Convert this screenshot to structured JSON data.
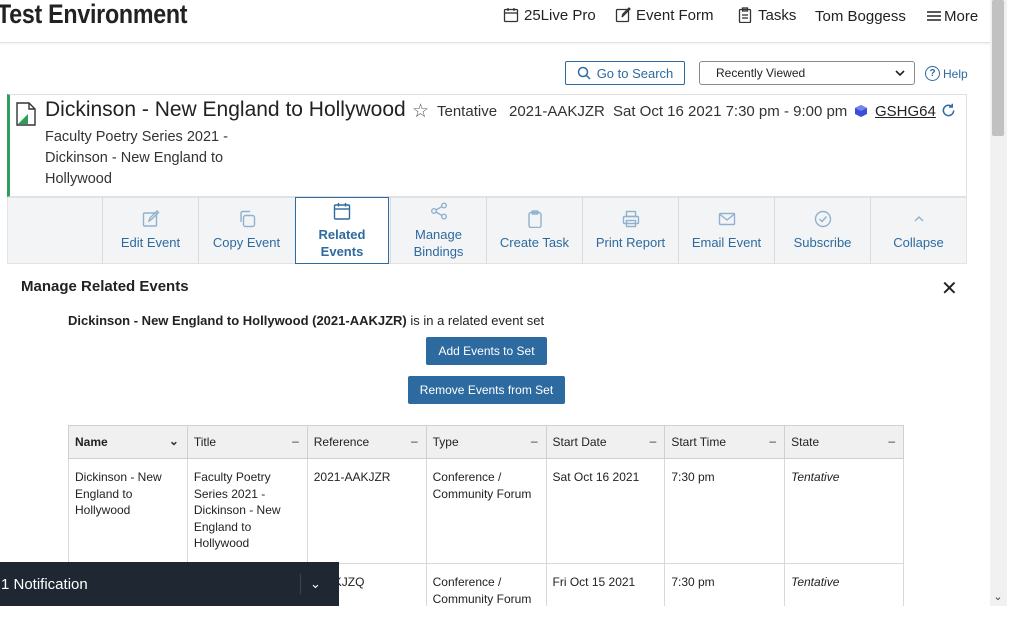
{
  "header": {
    "app_title": "Test Environment",
    "nav": {
      "pro": "25Live Pro",
      "event_form": "Event Form",
      "tasks": "Tasks",
      "user": "Tom Boggess",
      "more": "More"
    }
  },
  "search": {
    "go_to_search": "Go to Search",
    "recently_viewed": "Recently Viewed",
    "help": "Help"
  },
  "event": {
    "title": "Dickinson - New England to Hollywood",
    "state": "Tentative",
    "reference": "2021-AAKJZR",
    "datetime": "Sat Oct 16 2021 7:30 pm - 9:00 pm",
    "locker_code": "GSHG64",
    "subtitle": "Faculty Poetry Series 2021 - Dickinson - New England to Hollywood"
  },
  "actions": [
    {
      "label": "Edit Event",
      "icon": "edit-icon"
    },
    {
      "label": "Copy Event",
      "icon": "copy-icon"
    },
    {
      "label": "Related Events",
      "icon": "calendar-icon",
      "active": true
    },
    {
      "label": "Manage Bindings",
      "icon": "share-icon"
    },
    {
      "label": "Create Task",
      "icon": "clipboard-icon"
    },
    {
      "label": "Print Report",
      "icon": "printer-icon"
    },
    {
      "label": "Email Event",
      "icon": "mail-icon"
    },
    {
      "label": "Subscribe",
      "icon": "check-circle-icon"
    },
    {
      "label": "Collapse",
      "icon": "chevron-up-icon"
    }
  ],
  "related": {
    "heading": "Manage Related Events",
    "set_event": "Dickinson - New England to Hollywood (2021-AAKJZR)",
    "set_msg": " is in a related event set",
    "add_button": "Add Events to Set",
    "remove_button": "Remove Events from Set",
    "columns": [
      "Name",
      "Title",
      "Reference",
      "Type",
      "Start Date",
      "Start Time",
      "State"
    ],
    "rows": [
      {
        "name": "Dickinson - New England to Hollywood",
        "title": "Faculty Poetry Series 2021 - Dickinson - New England to Hollywood",
        "reference": "2021-AAKJZR",
        "type": "Conference / Community Forum",
        "start_date": "Sat Oct 16 2021",
        "start_time": "7:30 pm",
        "state": "Tentative"
      },
      {
        "name": "",
        "title": "",
        "reference": "-AAKJZQ",
        "type": "Conference / Community Forum",
        "start_date": "Fri Oct 15 2021",
        "start_time": "7:30 pm",
        "state": "Tentative"
      }
    ]
  },
  "notification": {
    "label": "1 Notification"
  }
}
